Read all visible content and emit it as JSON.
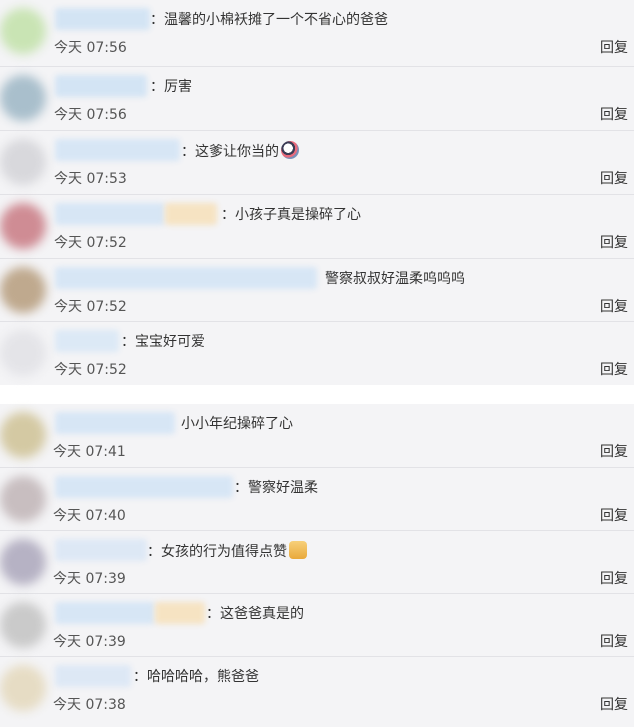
{
  "comments_group_1": [
    {
      "text": "：温馨的小棉袄摊了一个不省心的爸爸",
      "time": "今天 07:56",
      "reply": "回复"
    },
    {
      "text": "：厉害",
      "time": "今天 07:56",
      "reply": "回复"
    },
    {
      "text": "：这爹让你当的",
      "time": "今天 07:53",
      "reply": "回复",
      "emoji": "crying-face-icon"
    },
    {
      "text": "：小孩子真是操碎了心",
      "time": "今天 07:52",
      "reply": "回复"
    },
    {
      "text": "警察叔叔好温柔呜呜呜",
      "time": "今天 07:52",
      "reply": "回复"
    },
    {
      "text": "：宝宝好可爱",
      "time": "今天 07:52",
      "reply": "回复"
    }
  ],
  "comments_group_2": [
    {
      "text": "小小年纪操碎了心",
      "time": "今天 07:41",
      "reply": "回复"
    },
    {
      "text": "：警察好温柔",
      "time": "今天 07:40",
      "reply": "回复"
    },
    {
      "text": "：女孩的行为值得点赞",
      "time": "今天 07:39",
      "reply": "回复",
      "emoji": "thumbs-up-icon"
    },
    {
      "text": "：这爸爸真是的",
      "time": "今天 07:39",
      "reply": "回复"
    },
    {
      "text": "：哈哈哈哈，熊爸爸",
      "time": "今天 07:38",
      "reply": "回复"
    }
  ],
  "colors": {
    "panel_bg": "#f4f4f6",
    "name_blur_blue": "#cfe0f3",
    "name_blur_yellow": "#f6e3c2"
  }
}
